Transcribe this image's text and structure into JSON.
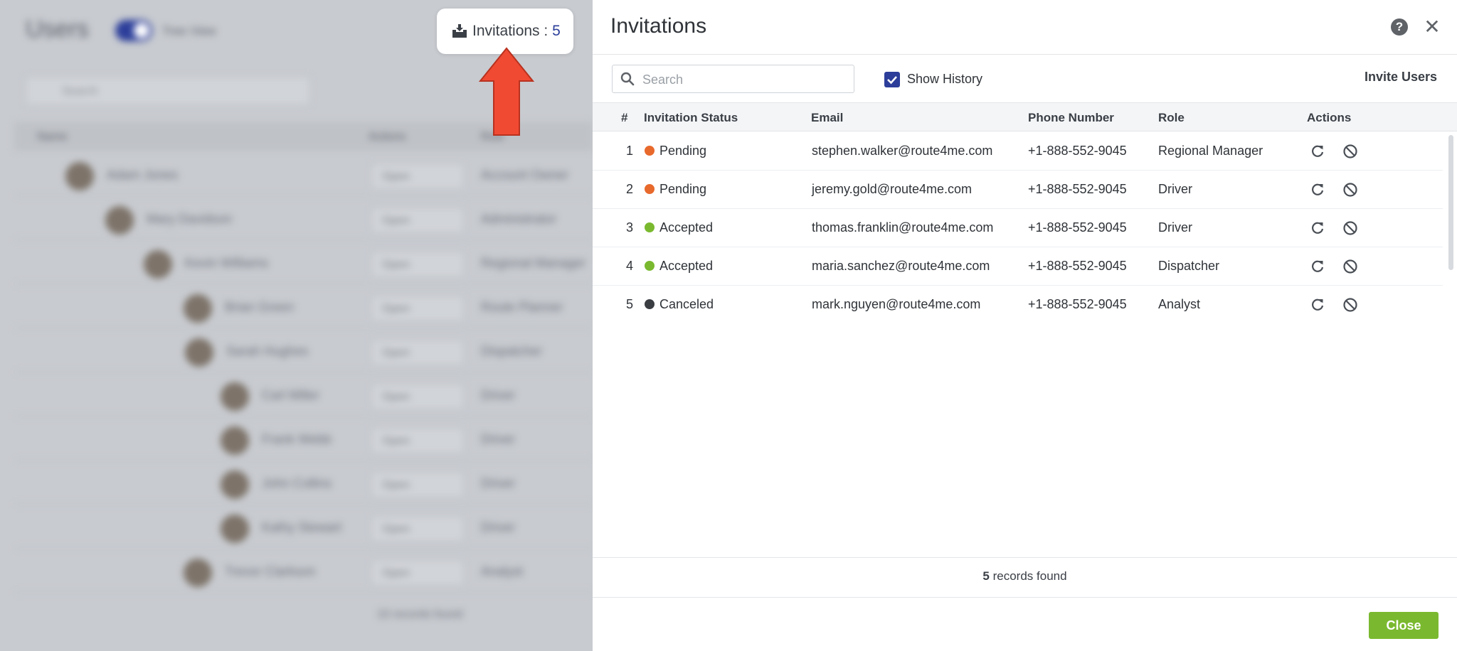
{
  "background": {
    "title": "Users",
    "tree_view_label": "Tree View",
    "search_placeholder": "Search",
    "columns": [
      "Name",
      "Actions",
      "Role"
    ],
    "rows": [
      {
        "name": "Adam Jones",
        "action": "Open",
        "role": "Account Owner"
      },
      {
        "name": "Mary Davidson",
        "action": "Open",
        "role": "Administrator"
      },
      {
        "name": "Kevin Williams",
        "action": "Open",
        "role": "Regional Manager"
      },
      {
        "name": "Brian Green",
        "action": "Open",
        "role": "Route Planner"
      },
      {
        "name": "Sarah Hughes",
        "action": "Open",
        "role": "Dispatcher"
      },
      {
        "name": "Carl Miller",
        "action": "Open",
        "role": "Driver"
      },
      {
        "name": "Frank Webb",
        "action": "Open",
        "role": "Driver"
      },
      {
        "name": "John Collins",
        "action": "Open",
        "role": "Driver"
      },
      {
        "name": "Kathy Stewart",
        "action": "Open",
        "role": "Driver"
      },
      {
        "name": "Trevor Clarkson",
        "action": "Open",
        "role": "Analyst"
      }
    ],
    "records_found": "10 records found"
  },
  "invitations_chip": {
    "label": "Invitations : ",
    "count": "5"
  },
  "panel": {
    "title": "Invitations",
    "search_placeholder": "Search",
    "show_history_label": "Show History",
    "show_history_checked": true,
    "invite_users_label": "Invite Users",
    "columns": {
      "num": "#",
      "status": "Invitation Status",
      "email": "Email",
      "phone": "Phone Number",
      "role": "Role",
      "actions": "Actions"
    },
    "rows": [
      {
        "num": "1",
        "status": "Pending",
        "email": "stephen.walker@route4me.com",
        "phone": "+1-888-552-9045",
        "role": "Regional Manager"
      },
      {
        "num": "2",
        "status": "Pending",
        "email": "jeremy.gold@route4me.com",
        "phone": "+1-888-552-9045",
        "role": "Driver"
      },
      {
        "num": "3",
        "status": "Accepted",
        "email": "thomas.franklin@route4me.com",
        "phone": "+1-888-552-9045",
        "role": "Driver"
      },
      {
        "num": "4",
        "status": "Accepted",
        "email": "maria.sanchez@route4me.com",
        "phone": "+1-888-552-9045",
        "role": "Dispatcher"
      },
      {
        "num": "5",
        "status": "Canceled",
        "email": "mark.nguyen@route4me.com",
        "phone": "+1-888-552-9045",
        "role": "Analyst"
      }
    ],
    "records_count": "5",
    "records_suffix": " records found",
    "close_label": "Close"
  },
  "colors": {
    "pending": "#e8692c",
    "accepted": "#7ab92f",
    "canceled": "#3a3d42",
    "accent": "#2c3e9a",
    "close_button": "#7ab92f",
    "arrow_red": "#f04a33",
    "arrow_blue": "#1f7be6"
  },
  "icons": {
    "chip": "inbox-download-icon",
    "search": "search-icon",
    "help": "help-icon",
    "close": "close-icon",
    "resend": "refresh-icon",
    "cancel": "ban-icon"
  }
}
